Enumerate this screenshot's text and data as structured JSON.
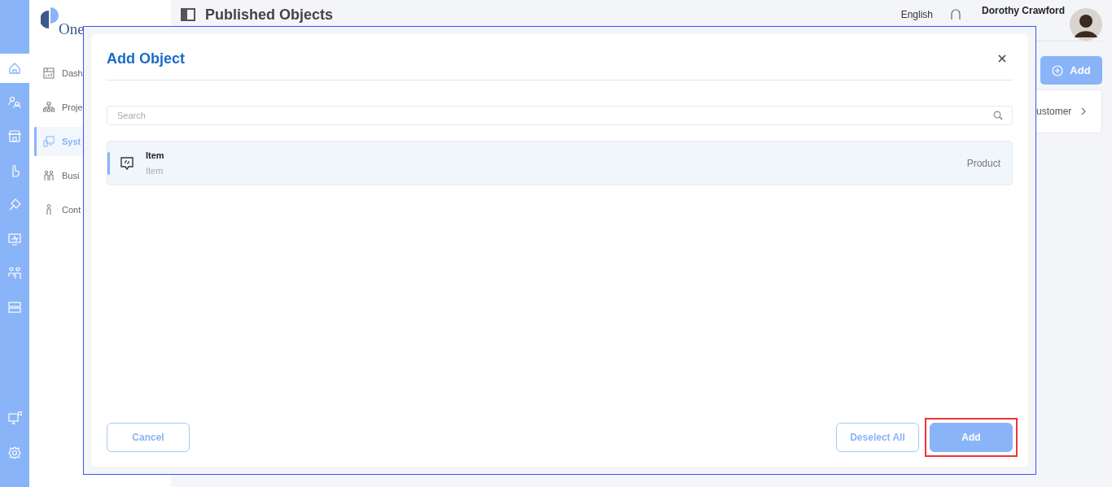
{
  "rail": {
    "items": [
      {
        "selected": true
      },
      {
        "selected": false
      },
      {
        "selected": false
      },
      {
        "selected": false
      },
      {
        "selected": false
      },
      {
        "selected": false
      },
      {
        "selected": false
      },
      {
        "selected": false
      }
    ]
  },
  "sidebar": {
    "logo": "One",
    "items": [
      {
        "label": "Dash",
        "selected": false
      },
      {
        "label": "Proje",
        "selected": false
      },
      {
        "label": "Syst",
        "selected": true
      },
      {
        "label": "Busi",
        "selected": false
      },
      {
        "label": "Cont",
        "selected": false
      }
    ]
  },
  "header": {
    "title": "Published Objects",
    "language": "English",
    "user": "Dorothy Crawford"
  },
  "page": {
    "add_button": "Add",
    "card_text": "ustomer"
  },
  "dialog": {
    "title": "Add Object",
    "search": {
      "placeholder": "Search"
    },
    "items": [
      {
        "name": "Item",
        "subtitle": "Item",
        "type": "Product",
        "selected": true
      }
    ],
    "buttons": [
      {
        "label": "Cancel",
        "kind": "outline",
        "highlighted": false
      },
      {
        "label": "Deselect All",
        "kind": "outline",
        "highlighted": false
      },
      {
        "label": "Add",
        "kind": "primary",
        "highlighted": true
      }
    ]
  }
}
